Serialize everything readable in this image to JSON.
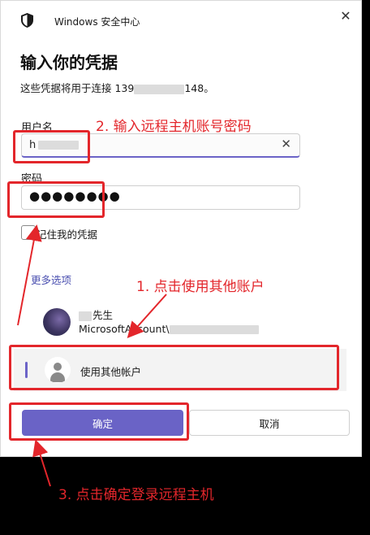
{
  "window": {
    "title": "Windows 安全中心",
    "close_glyph": "✕"
  },
  "dialog": {
    "heading": "输入你的凭据",
    "subtext_prefix": "这些凭据将用于连接 139",
    "subtext_suffix": "148。"
  },
  "fields": {
    "username_label": "用户名",
    "username_value": "h",
    "password_label": "密码",
    "password_mask": "●●●●●●●●"
  },
  "remember_label": "记住我的凭据",
  "more_options_label": "更多选项",
  "account": {
    "name_suffix": "先生",
    "id_prefix": "MicrosoftAccount\\"
  },
  "other_account_label": "使用其他帐户",
  "buttons": {
    "ok": "确定",
    "cancel": "取消"
  },
  "annotations": {
    "step1": "1. 点击使用其他账户",
    "step2": "2. 输入远程主机账号密码",
    "step3": "3. 点击确定登录远程主机"
  },
  "colors": {
    "accent": "#6a63c6",
    "annotation_red": "#e3262b",
    "link": "#4a4fb0"
  },
  "icons": {
    "window": "shield-icon",
    "clear": "clear-icon",
    "other_account": "person-icon"
  }
}
